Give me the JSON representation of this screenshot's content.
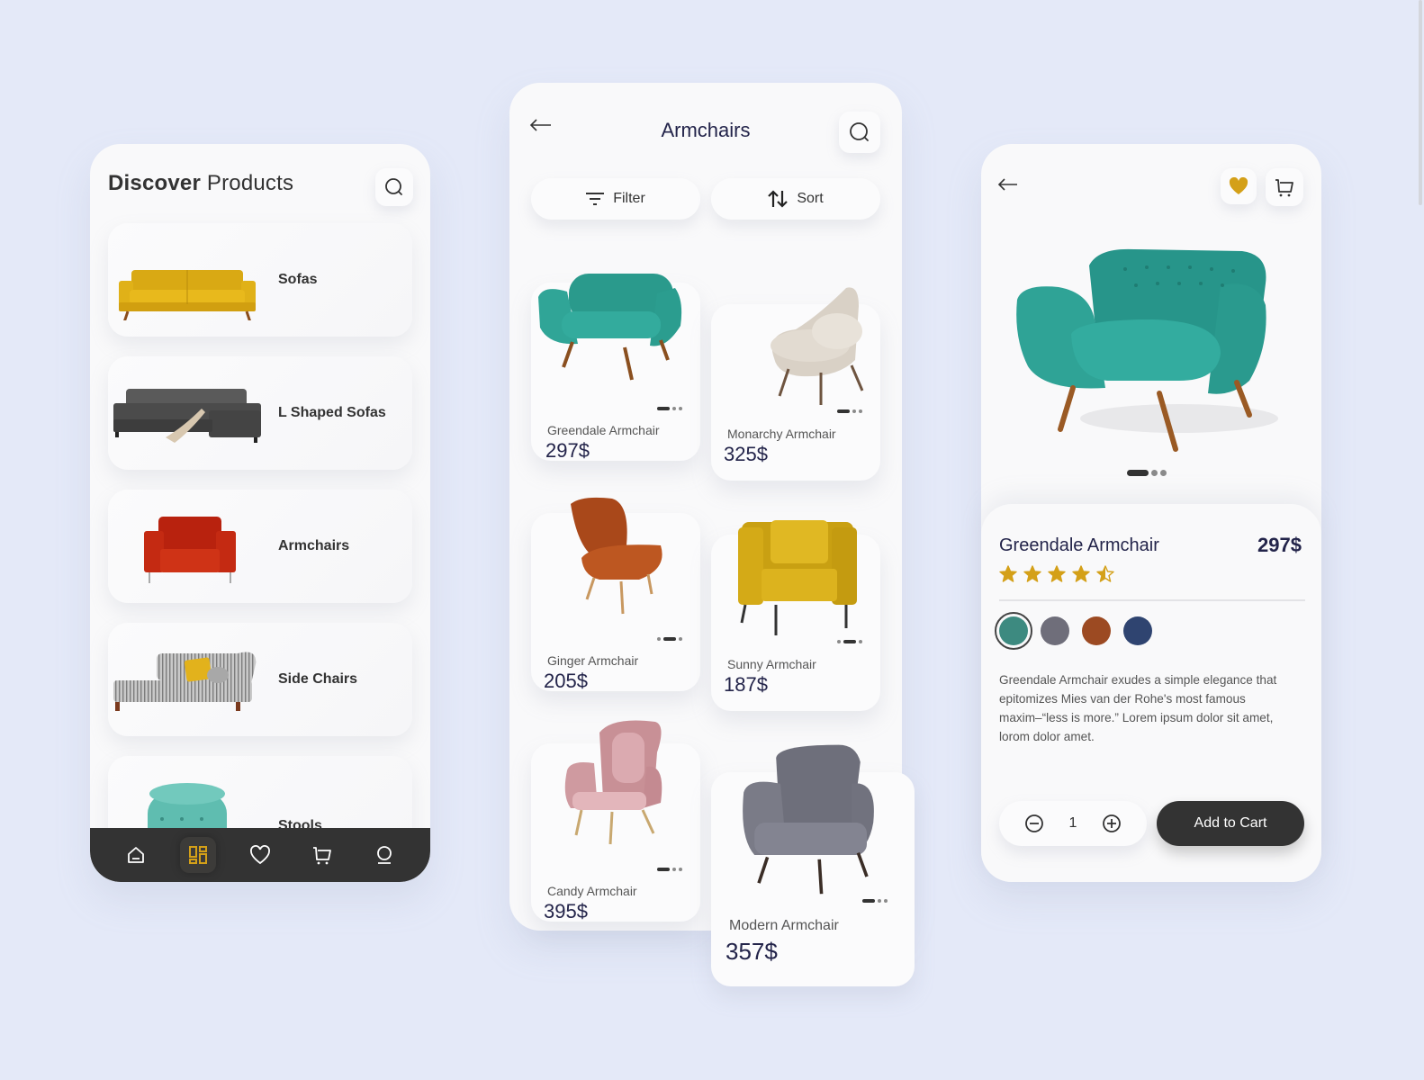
{
  "discover": {
    "title_bold": "Discover",
    "title_light": "Products",
    "search_icon": "search-icon",
    "categories": [
      {
        "label": "Sofas",
        "image": "yellow-sofa"
      },
      {
        "label": "L Shaped Sofas",
        "image": "grey-l-shaped-sofa"
      },
      {
        "label": "Armchairs",
        "image": "red-armchair"
      },
      {
        "label": "Side Chairs",
        "image": "striped-chaise-lounge"
      },
      {
        "label": "Stools",
        "image": "teal-tufted-stool"
      }
    ],
    "bottom_nav": [
      {
        "icon": "home-icon",
        "active": false
      },
      {
        "icon": "grid-icon",
        "active": true
      },
      {
        "icon": "heart-icon",
        "active": false
      },
      {
        "icon": "cart-icon",
        "active": false
      },
      {
        "icon": "profile-icon",
        "active": false
      }
    ]
  },
  "listing": {
    "title": "Armchairs",
    "filter_label": "Filter",
    "sort_label": "Sort",
    "products": [
      {
        "name": "Greendale Armchair",
        "price": "297$",
        "color": "#2f9a8c",
        "active_dot": 0
      },
      {
        "name": "Monarchy Armchair",
        "price": "325$",
        "color": "#d9d2c8",
        "active_dot": 0
      },
      {
        "name": "Ginger Armchair",
        "price": "205$",
        "color": "#b5531f",
        "active_dot": 1
      },
      {
        "name": "Sunny Armchair",
        "price": "187$",
        "color": "#d4a814",
        "active_dot": 1
      },
      {
        "name": "Candy Armchair",
        "price": "395$",
        "color": "#d5a0a6",
        "active_dot": 0
      },
      {
        "name": "Modern Armchair",
        "price": "357$",
        "color": "#7d7f8a",
        "active_dot": 0
      }
    ]
  },
  "detail": {
    "name": "Greendale Armchair",
    "price": "297$",
    "rating": 4.5,
    "rating_max": 5,
    "colors": [
      "#3d8a80",
      "#6f6e7a",
      "#9c4a22",
      "#2f4470"
    ],
    "selected_color": 0,
    "description": "Greendale Armchair exudes a simple elegance that epitomizes Mies van der Rohe's most famous maxim–“less is more.”  Lorem ipsum dolor sit amet, lorom dolor amet.",
    "quantity": "1",
    "add_to_cart_label": "Add to Cart",
    "favorited": true,
    "image_dots": 3,
    "active_image": 0
  },
  "colors": {
    "background": "#e4e9f8",
    "panel": "#f9f9fa",
    "dark": "#333333",
    "accent_gold": "#d4a018",
    "navy_text": "#23244a"
  }
}
